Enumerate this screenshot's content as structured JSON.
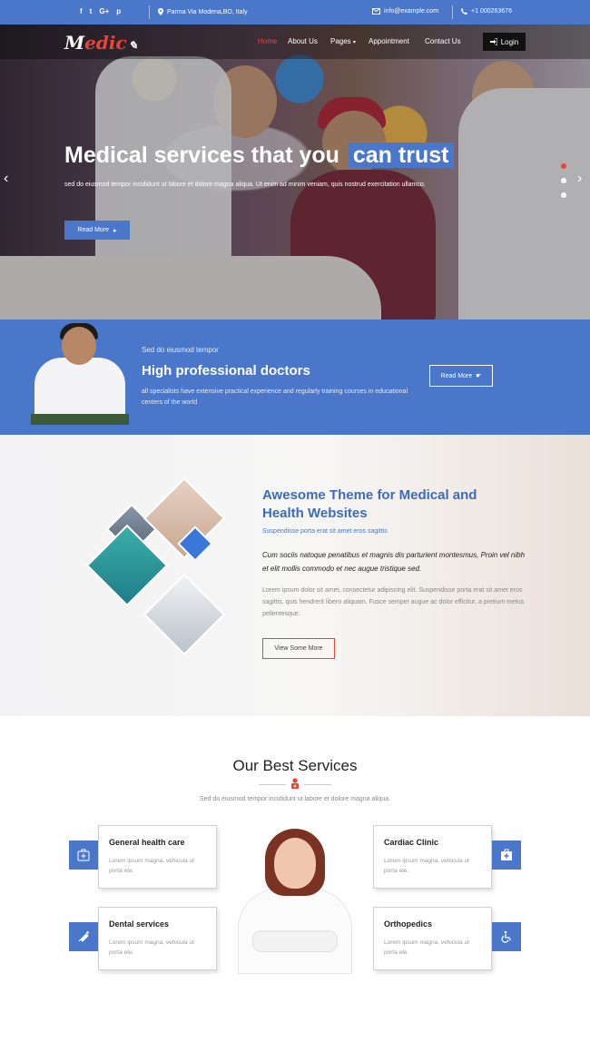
{
  "topbar": {
    "social": [
      "f",
      "t",
      "G+",
      "p"
    ],
    "address_icon": "map-marker-icon",
    "address": "Parma Via Modena,BO, Italy",
    "email_icon": "envelope-icon",
    "email": "info@example.com",
    "phone_icon": "phone-icon",
    "phone": "+1 000263676"
  },
  "nav": {
    "logo_main": "M",
    "logo_accent": "edic",
    "items": [
      "Home",
      "About Us",
      "Pages",
      "Appointment",
      "Contact Us"
    ],
    "active": "Home",
    "pages_caret": "▾",
    "login": "Login"
  },
  "hero": {
    "title_part1": "Medical services that you",
    "title_highlight": "can trust",
    "text": "sed do eiusmod tempor incididunt ut labore et dolore magna aliqua. Ut enim ad minim veniam, quis nostrud exercitation ullamco.",
    "button": "Read More",
    "prev": "‹",
    "next": "›"
  },
  "band": {
    "subtitle": "Sed do eiusmod tempor",
    "title": "High professional doctors",
    "description": "all specialists have extensive practical experience and regularly training courses in educational centers of the world",
    "button": "Read More"
  },
  "awesome": {
    "title": "Awesome Theme for Medical and Health Websites",
    "subtitle": "Suspendisse porta erat sit amet eros sagittis",
    "italic": "Cum sociis natoque penatibus et magnis dis parturient montesmus, Proin vel nibh et elit mollis commodo et nec augue tristique sed.",
    "text": "Lorem ipsum dolor sit amet, consectetur adipiscing elit. Suspendisse porta erat sit amet eros sagittis, quis hendrerit libero aliquam. Fusce semper augue ac dolor efficitur, a pretium metus pellentesque.",
    "button": "View Some More"
  },
  "services": {
    "title": "Our Best Services",
    "description": "Sed do eiusmod tempor incididunt ut labore et dolore magna aliqua.",
    "cards": [
      {
        "title": "General health care",
        "text": "Lorem ipsum magna, vehicula ut porta ete.",
        "icon": "first-aid-icon"
      },
      {
        "title": "Dental services",
        "text": "Lorem ipsum magna, vehicula ut porta ete.",
        "icon": "syringe-icon"
      },
      {
        "title": "Cardiac Clinic",
        "text": "Lorem ipsum magna, vehicula ut porta ete.",
        "icon": "medkit-icon"
      },
      {
        "title": "Orthopedics",
        "text": "Lorem ipsum magna, vehicula ut porta ete.",
        "icon": "wheelchair-icon"
      }
    ]
  },
  "colors": {
    "brand_blue": "#4a77c9",
    "accent_red": "#e8443a"
  }
}
